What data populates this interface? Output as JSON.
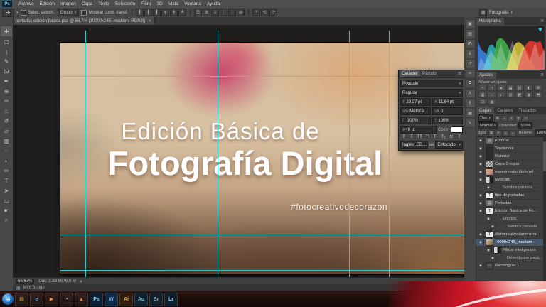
{
  "menubar": {
    "logo": "Ps",
    "items": [
      {
        "label": "Archivo"
      },
      {
        "label": "Edición"
      },
      {
        "label": "Imagen"
      },
      {
        "label": "Capa"
      },
      {
        "label": "Texto"
      },
      {
        "label": "Selección"
      },
      {
        "label": "Filtro"
      },
      {
        "label": "3D"
      },
      {
        "label": "Vista"
      },
      {
        "label": "Ventana"
      },
      {
        "label": "Ayuda"
      }
    ]
  },
  "options_bar": {
    "tool_glyph": "✛",
    "auto_select_label": "Selec. autom.:",
    "auto_select_value": "Grupo",
    "show_transform_label": "Mostrar contr. transf.",
    "align_icons": [
      {
        "glyph": "┠"
      },
      {
        "glyph": "╂"
      },
      {
        "glyph": "┨"
      },
      {
        "glyph": "┯"
      },
      {
        "glyph": "┿"
      },
      {
        "glyph": "┷"
      }
    ],
    "dist_icons": [
      {
        "glyph": "☰"
      },
      {
        "glyph": "≣"
      },
      {
        "glyph": "≡"
      },
      {
        "glyph": "⋮"
      },
      {
        "glyph": "⁞"
      },
      {
        "glyph": "▥"
      }
    ],
    "extra_icons": [
      {
        "glyph": "⌖"
      },
      {
        "glyph": "⟲"
      },
      {
        "glyph": "⟳"
      }
    ],
    "workspace": "Fotografía",
    "caret": "▾"
  },
  "document_tab": {
    "title": "portadas edición basica.psd @ 66.7% (10000x245_medium, RGB/8)",
    "close": "✕"
  },
  "toolbar": {
    "tools": [
      {
        "name": "move-tool",
        "glyph": "✛",
        "cls": "active"
      },
      {
        "name": "marquee-tool",
        "glyph": "▢"
      },
      {
        "name": "lasso-tool",
        "glyph": "ʅ"
      },
      {
        "name": "quick-selection-tool",
        "glyph": "✎"
      },
      {
        "name": "crop-tool",
        "glyph": "⊡"
      },
      {
        "name": "eyedropper-tool",
        "glyph": "✒"
      },
      {
        "name": "healing-brush-tool",
        "glyph": "⊕"
      },
      {
        "name": "brush-tool",
        "glyph": "✑"
      },
      {
        "name": "clone-stamp-tool",
        "glyph": "♨"
      },
      {
        "name": "history-brush-tool",
        "glyph": "↺"
      },
      {
        "name": "eraser-tool",
        "glyph": "▱"
      },
      {
        "name": "gradient-tool",
        "glyph": "▥"
      },
      {
        "name": "blur-tool",
        "glyph": "◌"
      },
      {
        "name": "dodge-tool",
        "glyph": "◐"
      },
      {
        "name": "pen-tool",
        "glyph": "✏"
      },
      {
        "name": "type-tool",
        "glyph": "T"
      },
      {
        "name": "path-selection-tool",
        "glyph": "➤"
      },
      {
        "name": "shape-tool",
        "glyph": "▭"
      },
      {
        "name": "hand-tool",
        "glyph": "☛"
      },
      {
        "name": "zoom-tool",
        "glyph": "⌕"
      }
    ]
  },
  "canvas": {
    "title_line1": "Edición Básica de",
    "title_line2": "Fotografía Digital",
    "hashtag": "#fotocreativodecorazon"
  },
  "character_panel": {
    "tabs": [
      {
        "label": "Carácter",
        "cls": "active"
      },
      {
        "label": "Párrafo"
      }
    ],
    "menu_icon": "≣",
    "font_family": "Rondale",
    "font_style": "Regular",
    "size_icon": "T",
    "size": "29,27 pt",
    "leading_icon": "A",
    "leading": "11,64 pt",
    "kerning_icon": "V⁄A",
    "kerning": "Métrica",
    "tracking_icon": "VA",
    "tracking": "0",
    "vscale_icon": "İT",
    "vscale": "100%",
    "hscale_icon": "T",
    "hscale": "100%",
    "baseline_icon": "Aª",
    "baseline": "0 pt",
    "color_label": "Color:",
    "faux_icons": [
      {
        "glyph": "T"
      },
      {
        "glyph": "T"
      },
      {
        "glyph": "TT"
      },
      {
        "glyph": "Tt"
      },
      {
        "glyph": "T¹"
      },
      {
        "glyph": "T₁"
      },
      {
        "glyph": "U"
      },
      {
        "glyph": "Ŧ"
      }
    ],
    "language": "Inglés: EE....",
    "aa_label": "aa",
    "antialias": "Enfocado",
    "caret": "▾"
  },
  "status_bar": {
    "zoom": "66.67%",
    "doc": "Doc: 2.93 M/76.8 M",
    "arrow": "▶",
    "mini_bridge": "Mini Bridge"
  },
  "dock": {
    "strip_icons": [
      {
        "name": "color-panel-icon",
        "glyph": "▣"
      },
      {
        "name": "swatches-panel-icon",
        "glyph": "▤"
      },
      {
        "name": "styles-panel-icon",
        "glyph": "◩"
      },
      {
        "name": "info-panel-icon",
        "glyph": "ℹ"
      },
      {
        "name": "history-panel-icon",
        "glyph": "↺"
      },
      {
        "name": "brush-panel-icon",
        "glyph": "✑"
      },
      {
        "name": "clone-source-panel-icon",
        "glyph": "⧉"
      },
      {
        "name": "character-panel-icon",
        "glyph": "A"
      },
      {
        "name": "paragraph-panel-icon",
        "glyph": "¶"
      },
      {
        "name": "layer-comps-panel-icon",
        "glyph": "▦"
      },
      {
        "name": "notes-panel-icon",
        "glyph": "✎"
      }
    ],
    "histogram": {
      "title": "Histograma",
      "menu": "≣"
    },
    "adjustments": {
      "title": "Ajustes",
      "menu": "≣",
      "add_label": "Añadir un ajuste",
      "icons": [
        {
          "glyph": "☀"
        },
        {
          "glyph": "◑"
        },
        {
          "glyph": "▲"
        },
        {
          "glyph": "⬓"
        },
        {
          "glyph": "▤"
        },
        {
          "glyph": "◧"
        },
        {
          "glyph": "⊞"
        },
        {
          "glyph": "▦"
        },
        {
          "glyph": "☼"
        },
        {
          "glyph": "◐"
        },
        {
          "glyph": "▥"
        },
        {
          "glyph": "◩"
        },
        {
          "glyph": "▣"
        },
        {
          "glyph": "⬒"
        },
        {
          "glyph": "⊡"
        },
        {
          "glyph": "▩"
        }
      ]
    },
    "layers": {
      "tabs": [
        {
          "label": "Capas",
          "cls": "active"
        },
        {
          "label": "Canales",
          "cls": "inactive"
        },
        {
          "label": "Trazados",
          "cls": "inactive"
        }
      ],
      "filter_label": "Tipo",
      "filter_icons": [
        {
          "glyph": "▦"
        },
        {
          "glyph": "◑"
        },
        {
          "glyph": "T"
        },
        {
          "glyph": "◧"
        },
        {
          "glyph": "▭"
        }
      ],
      "blend_mode": "Normal",
      "opacity_label": "Opacidad:",
      "opacity_value": "100%",
      "lock_label": "Bloq:",
      "lock_icons": [
        {
          "glyph": "▦"
        },
        {
          "glyph": "✛"
        },
        {
          "glyph": "◘"
        },
        {
          "glyph": "▪"
        }
      ],
      "fill_label": "Relleno:",
      "fill_value": "100%",
      "rows": [
        {
          "eye": "on",
          "thumb": "t-group",
          "tglyph": "▤",
          "name": "Puntual"
        },
        {
          "eye": "on",
          "thumb": "t-dark",
          "name": "Tendencia"
        },
        {
          "eye": "on",
          "thumb": "t-dark",
          "name": "Material"
        },
        {
          "eye": "on",
          "thumb": "t-checker",
          "name": "Capa 0 copia"
        },
        {
          "eye": "on",
          "thumb": "t-img",
          "name": "experimento título a4"
        },
        {
          "eye": "on",
          "thumb": "t-mask",
          "name": "Máscara"
        },
        {
          "eye": "on",
          "cls": "indent fxrow",
          "thumb": "t-none",
          "name": "Sombra paralela"
        },
        {
          "eye": "on",
          "thumb": "t-text",
          "tglyph": "T",
          "name": "tipo de portadas"
        },
        {
          "eye": "on",
          "thumb": "t-group",
          "tglyph": "▤",
          "name": "Portadas"
        },
        {
          "eye": "on",
          "thumb": "t-text",
          "tglyph": "T",
          "name": "Edición Básica de Fo..."
        },
        {
          "eye": "on",
          "cls": "indent fxrow",
          "thumb": "t-none",
          "name": "Efectos"
        },
        {
          "eye": "on",
          "cls": "indent2 fxrow",
          "thumb": "t-none",
          "name": "Sombra paralela"
        },
        {
          "eye": "on",
          "thumb": "t-text",
          "tglyph": "T",
          "name": "#fotocreativodecorazon"
        },
        {
          "eye": "on",
          "cls": "sel",
          "thumb": "t-img2",
          "name": "10000x245_medium"
        },
        {
          "eye": "on",
          "cls": "indent",
          "thumb": "t-mask",
          "name": "Filtros inteligentes"
        },
        {
          "eye": "on",
          "cls": "indent2 fxrow",
          "thumb": "t-none",
          "name": "Desenfoque gaussiano"
        },
        {
          "eye": "on",
          "thumb": "t-shape",
          "tglyph": "▭",
          "name": "Rectángulo 1"
        }
      ],
      "bottom_icons": [
        {
          "name": "link-layers-icon",
          "glyph": "⧉"
        },
        {
          "name": "layer-style-icon",
          "glyph": "fx"
        },
        {
          "name": "add-layer-mask-icon",
          "glyph": "◧"
        },
        {
          "name": "adjustment-layer-icon",
          "glyph": "◑"
        },
        {
          "name": "new-group-icon",
          "glyph": "▣"
        },
        {
          "name": "new-layer-icon",
          "glyph": "⊞"
        },
        {
          "name": "delete-layer-icon",
          "glyph": "✕"
        }
      ]
    }
  },
  "taskbar": {
    "items": [
      {
        "name": "start-button",
        "glyph": "⊞",
        "cls": "start"
      },
      {
        "name": "explorer-icon",
        "glyph": "▤",
        "cls": "folder"
      },
      {
        "name": "internet-explorer-icon",
        "glyph": "e",
        "cls": "ie"
      },
      {
        "name": "media-player-icon",
        "glyph": "▶",
        "cls": "media"
      },
      {
        "name": "chrome-icon",
        "glyph": "◔",
        "cls": "chrome"
      },
      {
        "name": "vlc-icon",
        "glyph": "▲",
        "cls": "vlc"
      },
      {
        "name": "photoshop-icon",
        "glyph": "Ps",
        "cls": "ps"
      },
      {
        "name": "word-icon",
        "glyph": "W",
        "cls": "word"
      },
      {
        "name": "illustrator-icon",
        "glyph": "Ai",
        "cls": "ai"
      },
      {
        "name": "audition-icon",
        "glyph": "Au",
        "cls": "au"
      },
      {
        "name": "bridge-icon",
        "glyph": "Br",
        "cls": "br"
      },
      {
        "name": "lightroom-icon",
        "glyph": "Lr",
        "cls": "lr"
      }
    ]
  }
}
